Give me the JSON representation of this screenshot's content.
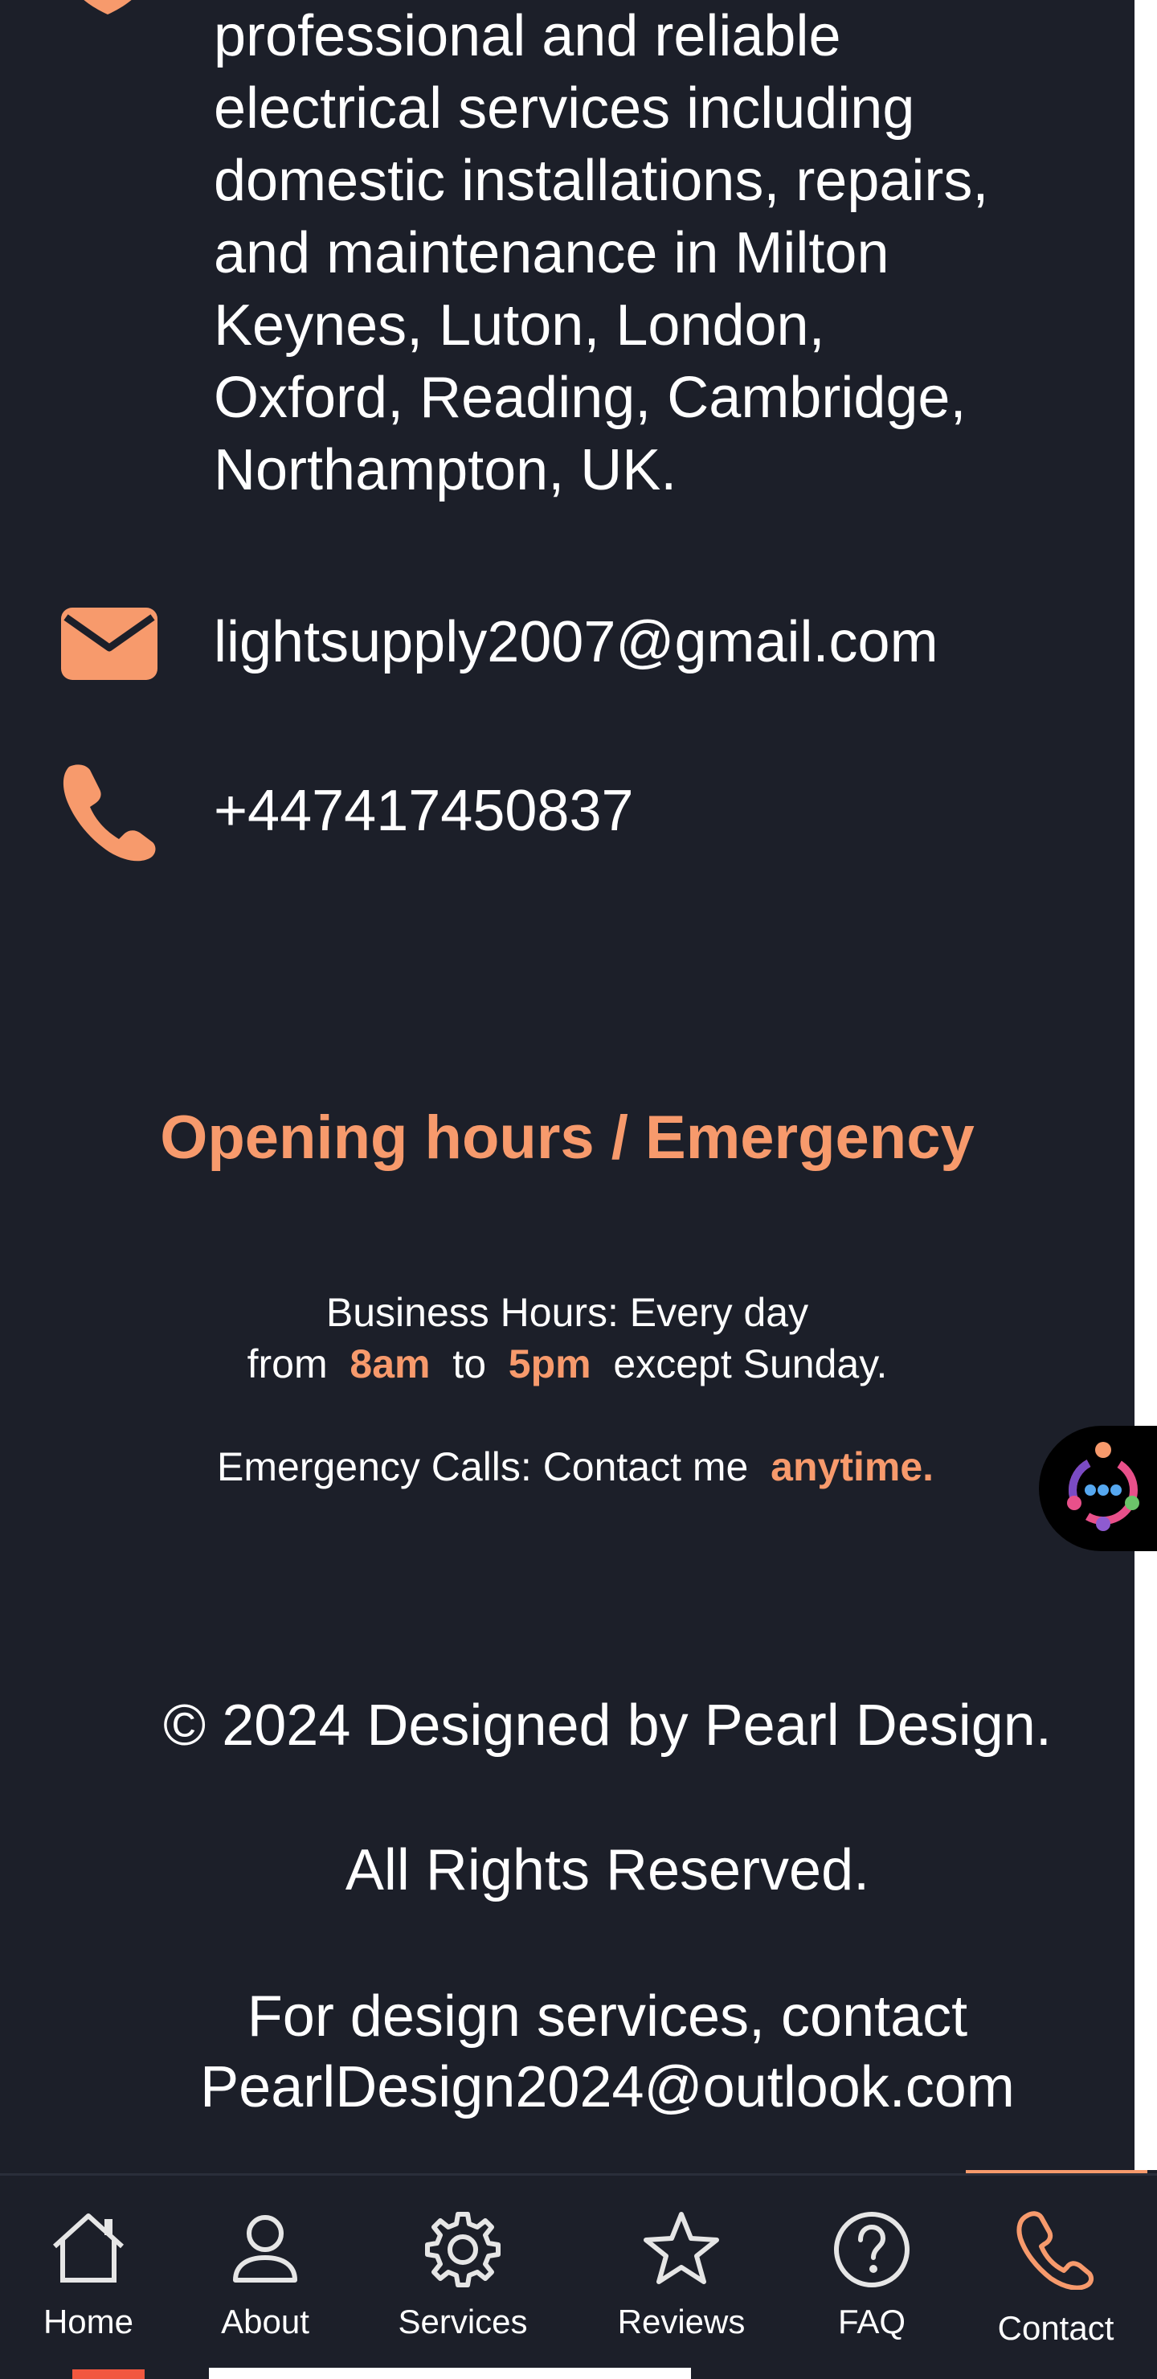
{
  "contact": {
    "address": "Light Supply LTD provides professional and reliable electrical services including domestic installations, repairs, and maintenance in Milton Keynes, Luton, London, Oxford, Reading, Cambridge, Northampton, UK.",
    "address_lines": [
      "professional and reliable",
      "electrical services including",
      "domestic installations, repairs,",
      "and maintenance in Milton",
      "Keynes, Luton, London,",
      "Oxford, Reading, Cambridge,",
      "Northampton, UK."
    ],
    "email": "lightsupply2007@gmail.com",
    "phone": "+447417450837"
  },
  "hours": {
    "title": "Opening hours / Emergency",
    "line1": "Business Hours: Every day",
    "from_label": "from",
    "open_time": "8am",
    "to_label": "to",
    "close_time": "5pm",
    "except_label": "except Sunday.",
    "emergency_label": "Emergency Calls: Contact me",
    "emergency_accent": "anytime."
  },
  "footer": {
    "copyright": "© 2024 Designed by Pearl Design.",
    "rights": "All Rights Reserved.",
    "design_line1": "For design services, contact",
    "design_line2": "PearlDesign2024@outlook.com"
  },
  "nav": {
    "items": [
      {
        "label": "Home",
        "icon": "home-icon"
      },
      {
        "label": "About",
        "icon": "user-icon"
      },
      {
        "label": "Services",
        "icon": "gear-icon"
      },
      {
        "label": "Reviews",
        "icon": "star-icon"
      },
      {
        "label": "FAQ",
        "icon": "question-icon"
      },
      {
        "label": "Contact",
        "icon": "phone-icon"
      }
    ],
    "active": "Contact"
  },
  "colors": {
    "background": "#1c1f29",
    "accent": "#f79a6c",
    "text": "#ffffff"
  }
}
